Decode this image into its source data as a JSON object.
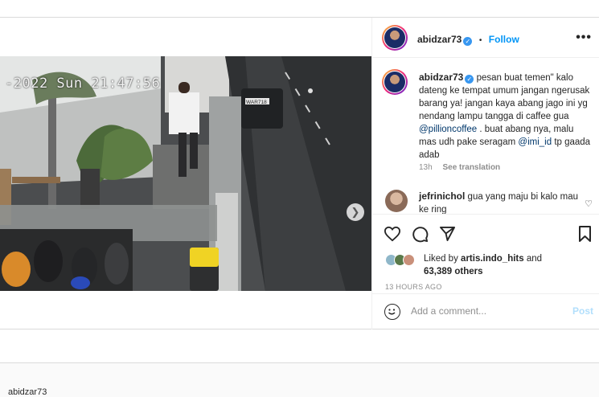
{
  "post": {
    "username": "abidzar73",
    "separator": "•",
    "follow_label": "Follow",
    "more_label": "•••",
    "video": {
      "overlay_timestamp": "-2022 Sun 21:47:56",
      "plate_text": "WAR718"
    },
    "caption": {
      "username": "abidzar73",
      "text_1": "pesan buat temen\" kalo dateng ke tempat umum jangan ngerusak barang ya! jangan kaya abang jago ini yg nendang lampu tangga di caffee gua",
      "mention_1": "@pillioncoffee",
      "text_2": ". buat abang nya, malu mas udh pake seragam",
      "mention_2": "@imi_id",
      "text_3": "tp gaada adab",
      "age": "13h",
      "see_translation": "See translation"
    },
    "comment": {
      "username": "jefrinichol",
      "text": "gua yang maju bi kalo mau ke ring"
    },
    "likes": {
      "prefix": "Liked by",
      "user": "artis.indo_hits",
      "and": "and",
      "count": "63,389 others"
    },
    "time_ago": "13 HOURS AGO",
    "comment_box": {
      "placeholder": "Add a comment...",
      "post_label": "Post"
    },
    "bottom_username": "abidzar73"
  },
  "colors": {
    "link_blue": "#0095f6",
    "verified_blue": "#3897f0",
    "mention_navy": "#00376b",
    "muted_gray": "#8e8e8e",
    "post_disabled": "#b2dffc"
  }
}
